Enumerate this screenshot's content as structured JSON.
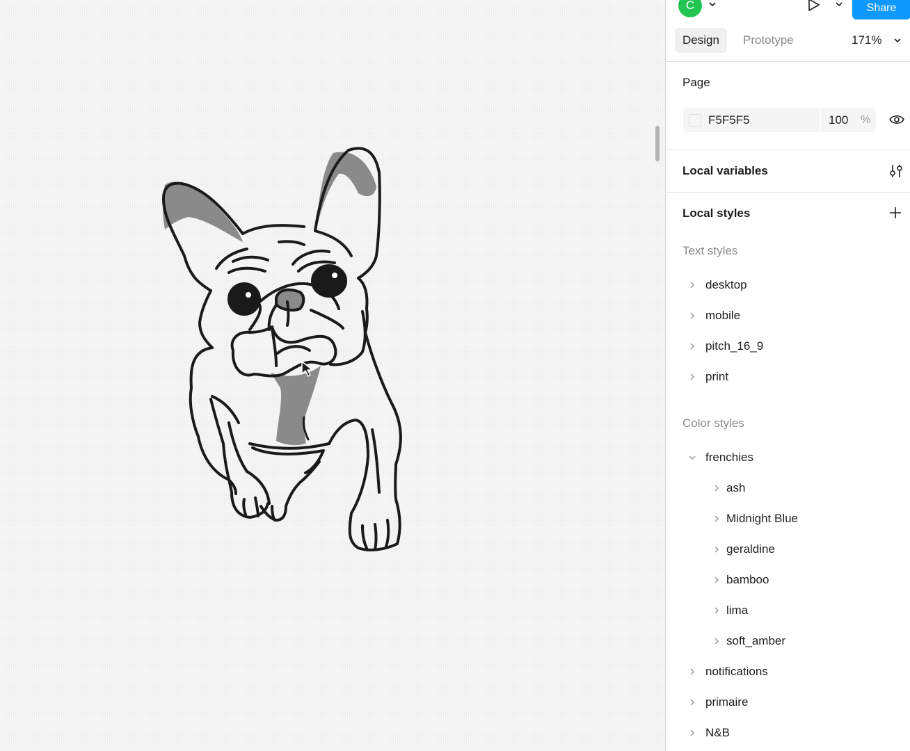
{
  "header": {
    "avatar_initial": "C",
    "share_label": "Share",
    "tabs": {
      "design": "Design",
      "prototype": "Prototype"
    },
    "zoom": "171%"
  },
  "page_section": {
    "title": "Page",
    "background_hex": "F5F5F5",
    "opacity": "100",
    "opacity_unit": "%"
  },
  "local_variables": {
    "title": "Local variables"
  },
  "local_styles": {
    "title": "Local styles",
    "text_styles_label": "Text styles",
    "text_styles": [
      "desktop",
      "mobile",
      "pitch_16_9",
      "print"
    ],
    "color_styles_label": "Color styles",
    "color_groups": [
      {
        "name": "frenchies",
        "expanded": true,
        "children": [
          "ash",
          "Midnight Blue",
          "geraldine",
          "bamboo",
          "lima",
          "soft_amber"
        ]
      },
      {
        "name": "notifications"
      },
      {
        "name": "primaire"
      },
      {
        "name": "N&B"
      }
    ]
  },
  "colors": {
    "accent": "#0d99ff",
    "avatar": "#23c552",
    "canvas": "#f5f5f5"
  }
}
